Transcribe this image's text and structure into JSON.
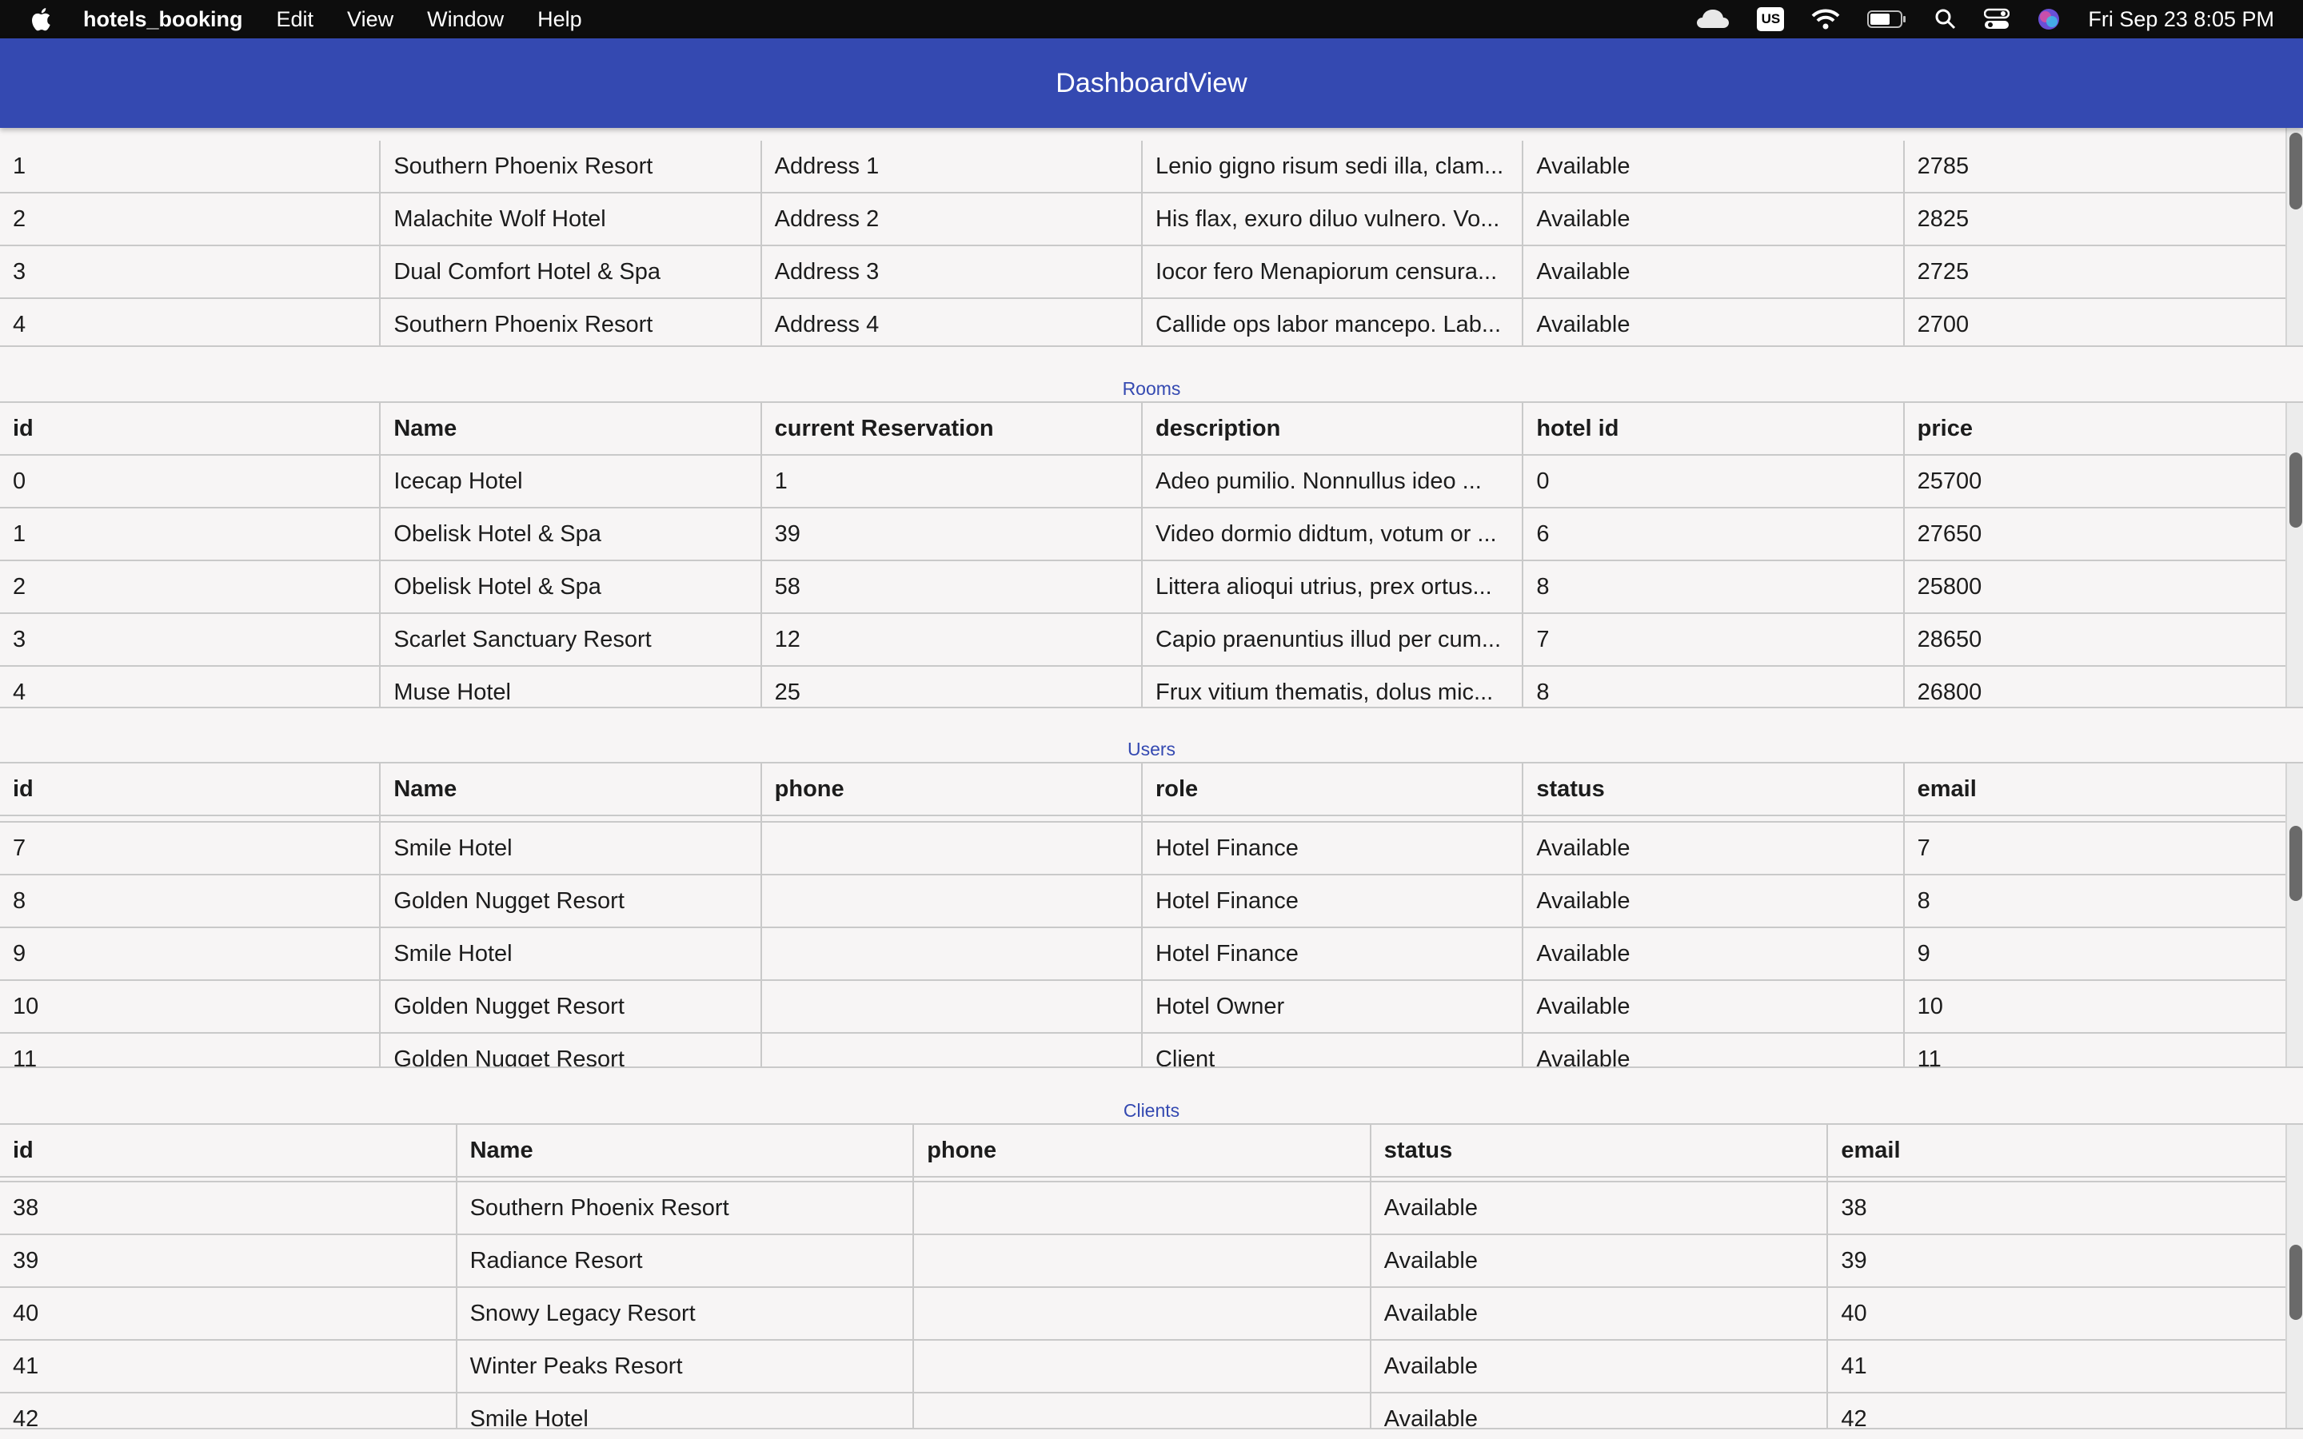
{
  "menubar": {
    "app_name": "hotels_booking",
    "menus": [
      "Edit",
      "View",
      "Window",
      "Help"
    ],
    "keyboard_layout": "US",
    "clock": "Fri Sep 23  8:05 PM",
    "icons": [
      "apple-icon",
      "cloud-icon",
      "keyboard-icon",
      "wifi-icon",
      "battery-icon",
      "search-icon",
      "control-center-icon",
      "siri-icon"
    ]
  },
  "window": {
    "title": "DashboardView",
    "accent": "#3449b1"
  },
  "hotels": {
    "rows": [
      [
        "1",
        "Southern Phoenix Resort",
        "Address 1",
        "Lenio gigno risum sedi illa, clam...",
        "Available",
        "2785"
      ],
      [
        "2",
        "Malachite Wolf Hotel",
        "Address 2",
        "His flax, exuro diluo vulnero. Vo...",
        "Available",
        "2825"
      ],
      [
        "3",
        "Dual Comfort Hotel & Spa",
        "Address 3",
        "Iocor fero Menapiorum censura...",
        "Available",
        "2725"
      ],
      [
        "4",
        "Southern Phoenix Resort",
        "Address 4",
        "Callide ops labor mancepo. Lab...",
        "Available",
        "2700"
      ]
    ]
  },
  "rooms": {
    "title": "Rooms",
    "columns": [
      "id",
      "Name",
      "current Reservation",
      "description",
      "hotel id",
      "price"
    ],
    "rows": [
      [
        "0",
        "Icecap Hotel",
        "1",
        "Adeo pumilio. Nonnullus ideo ...",
        "0",
        "25700"
      ],
      [
        "1",
        "Obelisk Hotel & Spa",
        "39",
        "Video dormio didtum, votum or ...",
        "6",
        "27650"
      ],
      [
        "2",
        "Obelisk Hotel & Spa",
        "58",
        "Littera alioqui utrius, prex ortus...",
        "8",
        "25800"
      ],
      [
        "3",
        "Scarlet Sanctuary Resort",
        "12",
        "Capio praenuntius illud per cum...",
        "7",
        "28650"
      ],
      [
        "4",
        "Muse Hotel",
        "25",
        "Frux vitium thematis, dolus mic...",
        "8",
        "26800"
      ]
    ]
  },
  "users": {
    "title": "Users",
    "columns": [
      "id",
      "Name",
      "phone",
      "role",
      "status",
      "email"
    ],
    "rows": [
      [
        "7",
        "Smile Hotel",
        "",
        "Hotel Finance",
        "Available",
        "7"
      ],
      [
        "8",
        "Golden Nugget Resort",
        "",
        "Hotel Finance",
        "Available",
        "8"
      ],
      [
        "9",
        "Smile Hotel",
        "",
        "Hotel Finance",
        "Available",
        "9"
      ],
      [
        "10",
        "Golden Nugget Resort",
        "",
        "Hotel Owner",
        "Available",
        "10"
      ],
      [
        "11",
        "Golden Nugget Resort",
        "",
        "Client",
        "Available",
        "11"
      ]
    ]
  },
  "clients": {
    "title": "Clients",
    "columns": [
      "id",
      "Name",
      "phone",
      "status",
      "email"
    ],
    "rows": [
      [
        "38",
        "Southern Phoenix Resort",
        "",
        "Available",
        "38"
      ],
      [
        "39",
        "Radiance Resort",
        "",
        "Available",
        "39"
      ],
      [
        "40",
        "Snowy Legacy Resort",
        "",
        "Available",
        "40"
      ],
      [
        "41",
        "Winter Peaks Resort",
        "",
        "Available",
        "41"
      ],
      [
        "42",
        "Smile Hotel",
        "",
        "Available",
        "42"
      ]
    ]
  }
}
